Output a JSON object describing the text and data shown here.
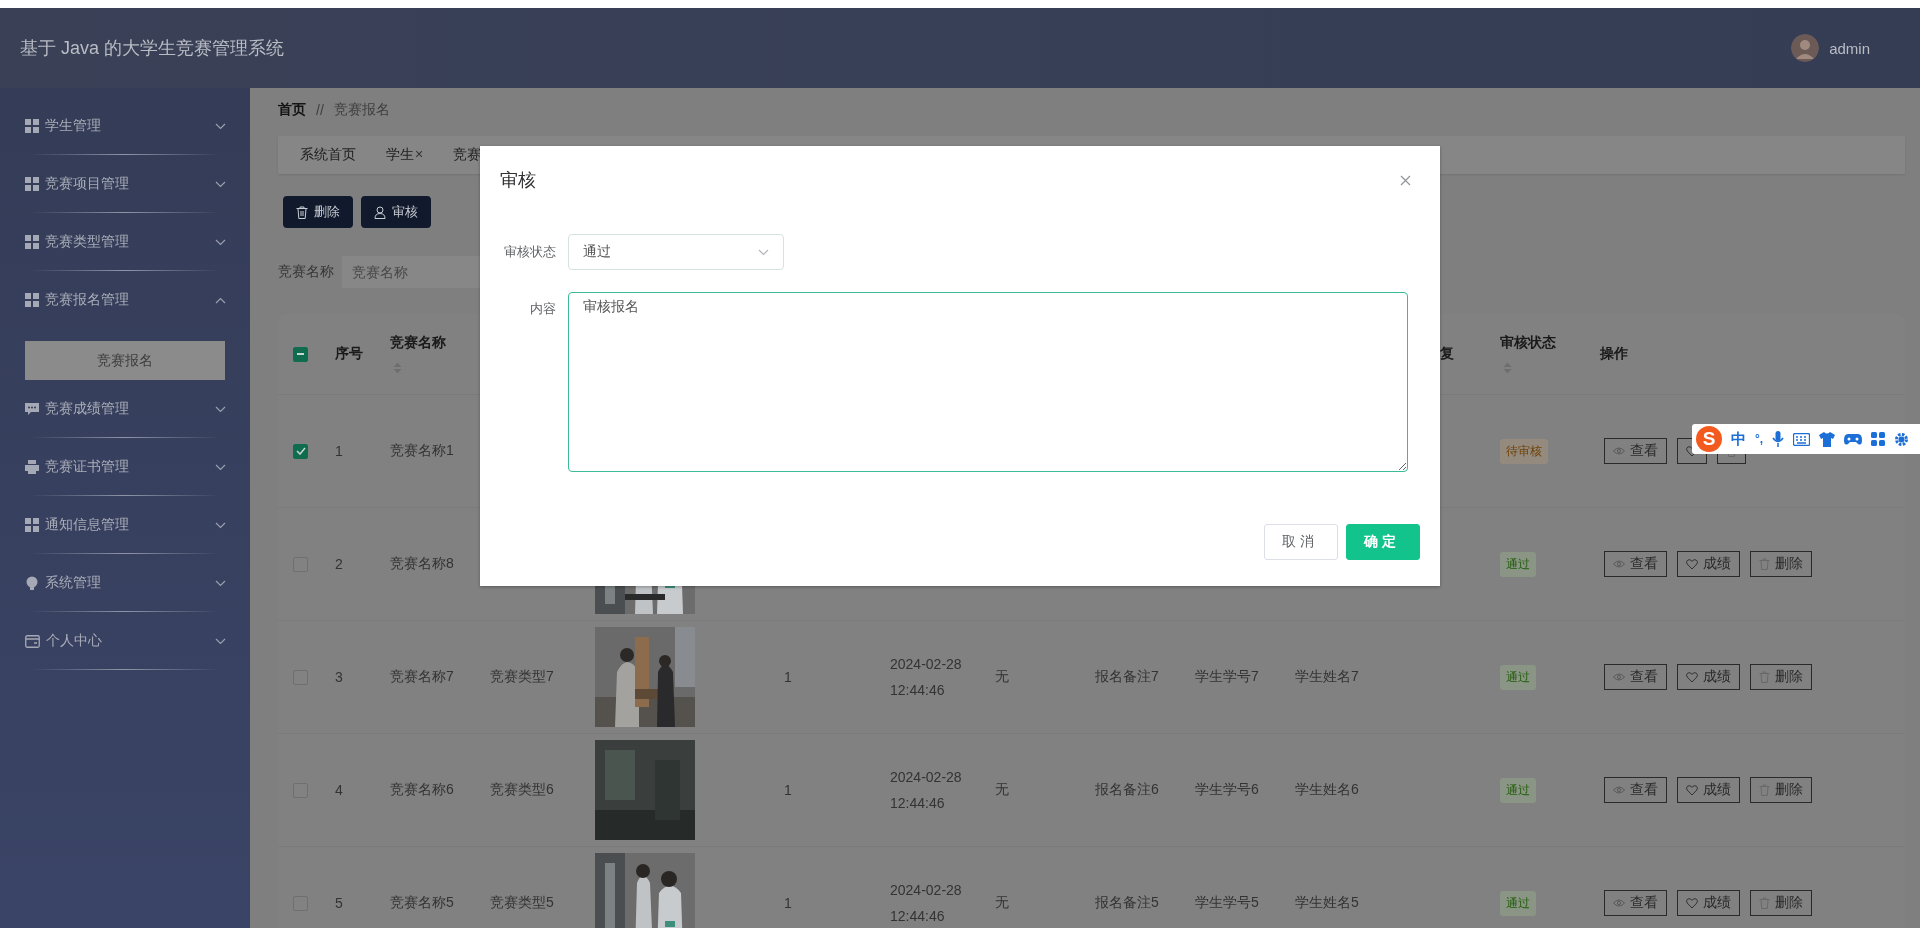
{
  "header": {
    "title": "基于 Java 的大学生竞赛管理系统",
    "user": "admin"
  },
  "sidebar": {
    "items": [
      {
        "label": "学生管理",
        "kind": "grid",
        "expanded": false
      },
      {
        "label": "竞赛项目管理",
        "kind": "grid",
        "expanded": false
      },
      {
        "label": "竞赛类型管理",
        "kind": "grid",
        "expanded": false
      },
      {
        "label": "竞赛报名管理",
        "kind": "grid",
        "expanded": true,
        "children": [
          {
            "label": "竞赛报名",
            "selected": true
          }
        ]
      },
      {
        "label": "竞赛成绩管理",
        "kind": "chat",
        "expanded": false
      },
      {
        "label": "竞赛证书管理",
        "kind": "printer",
        "expanded": false
      },
      {
        "label": "通知信息管理",
        "kind": "grid",
        "expanded": false
      },
      {
        "label": "系统管理",
        "kind": "bulb",
        "expanded": false
      },
      {
        "label": "个人中心",
        "kind": "wallet",
        "expanded": false
      }
    ]
  },
  "breadcrumb": {
    "items": [
      "首页",
      "竞赛报名"
    ],
    "separator": "//"
  },
  "tabs": [
    {
      "label": "系统首页"
    },
    {
      "label": "学生",
      "close": "×"
    },
    {
      "label": "竞赛"
    }
  ],
  "toolbar": [
    {
      "label": "删除",
      "kind": "delete"
    },
    {
      "label": "审核",
      "kind": "audit"
    }
  ],
  "search": {
    "label": "竞赛名称",
    "placeholder": "竞赛名称"
  },
  "table": {
    "select_all": {
      "indeterminate": true
    },
    "header": {
      "index": {
        "label": "序号"
      },
      "name": {
        "label": "竞赛名称",
        "sortable": true
      },
      "column_12": {
        "label": "复"
      },
      "status": {
        "label": "审核状态",
        "sortable": true
      },
      "actions": {
        "label": "操作"
      }
    },
    "rows": [
      {
        "selected": true,
        "index": "1",
        "name": "竞赛名称1",
        "status": {
          "label": "待审核",
          "kind": "pending"
        },
        "actions": [
          {
            "label": "查看",
            "kind": "view"
          },
          {
            "kind": "score"
          },
          {
            "kind": "delete"
          }
        ]
      },
      {
        "selected": false,
        "index": "2",
        "name": "竞赛名称8",
        "image": {
          "kind": "picture"
        },
        "status": {
          "label": "通过",
          "kind": "passed"
        },
        "actions": [
          {
            "label": "查看",
            "kind": "view"
          },
          {
            "label": "成绩",
            "kind": "score"
          },
          {
            "label": "删除",
            "kind": "delete"
          }
        ]
      },
      {
        "selected": false,
        "index": "3",
        "name": "竞赛名称7",
        "type": "竞赛类型7",
        "image": {
          "kind": "picture"
        },
        "column_6": "1",
        "date": [
          "2024-02-28",
          "12:44:46"
        ],
        "column_8": "无",
        "remark": "报名备注7",
        "student_no": "学生学号7",
        "student_name": "学生姓名7",
        "status": {
          "label": "通过",
          "kind": "passed"
        },
        "actions": [
          {
            "label": "查看",
            "kind": "view"
          },
          {
            "label": "成绩",
            "kind": "score"
          },
          {
            "label": "删除",
            "kind": "delete"
          }
        ]
      },
      {
        "selected": false,
        "index": "4",
        "name": "竞赛名称6",
        "type": "竞赛类型6",
        "image": {
          "kind": "picture"
        },
        "column_6": "1",
        "date": [
          "2024-02-28",
          "12:44:46"
        ],
        "column_8": "无",
        "remark": "报名备注6",
        "student_no": "学生学号6",
        "student_name": "学生姓名6",
        "status": {
          "label": "通过",
          "kind": "passed"
        },
        "actions": [
          {
            "label": "查看",
            "kind": "view"
          },
          {
            "label": "成绩",
            "kind": "score"
          },
          {
            "label": "删除",
            "kind": "delete"
          }
        ]
      },
      {
        "selected": false,
        "index": "5",
        "name": "竞赛名称5",
        "type": "竞赛类型5",
        "image": {
          "kind": "picture"
        },
        "column_6": "1",
        "date": [
          "2024-02-28",
          "12:44:46"
        ],
        "column_8": "无",
        "remark": "报名备注5",
        "student_no": "学生学号5",
        "student_name": "学生姓名5",
        "status": {
          "label": "通过",
          "kind": "passed"
        },
        "actions": [
          {
            "label": "查看",
            "kind": "view"
          },
          {
            "label": "成绩",
            "kind": "score"
          },
          {
            "label": "删除",
            "kind": "delete"
          }
        ]
      }
    ]
  },
  "dialog": {
    "title": "审核",
    "status_label": "审核状态",
    "status_value": "通过",
    "content_label": "内容",
    "content_value": "审核报名",
    "buttons": [
      {
        "label": "取消",
        "kind": "cancel"
      },
      {
        "label": "确定",
        "kind": "confirm"
      }
    ]
  },
  "ime_toolbar": {
    "logo": "S",
    "mode": "中",
    "punctuation": "°,"
  }
}
